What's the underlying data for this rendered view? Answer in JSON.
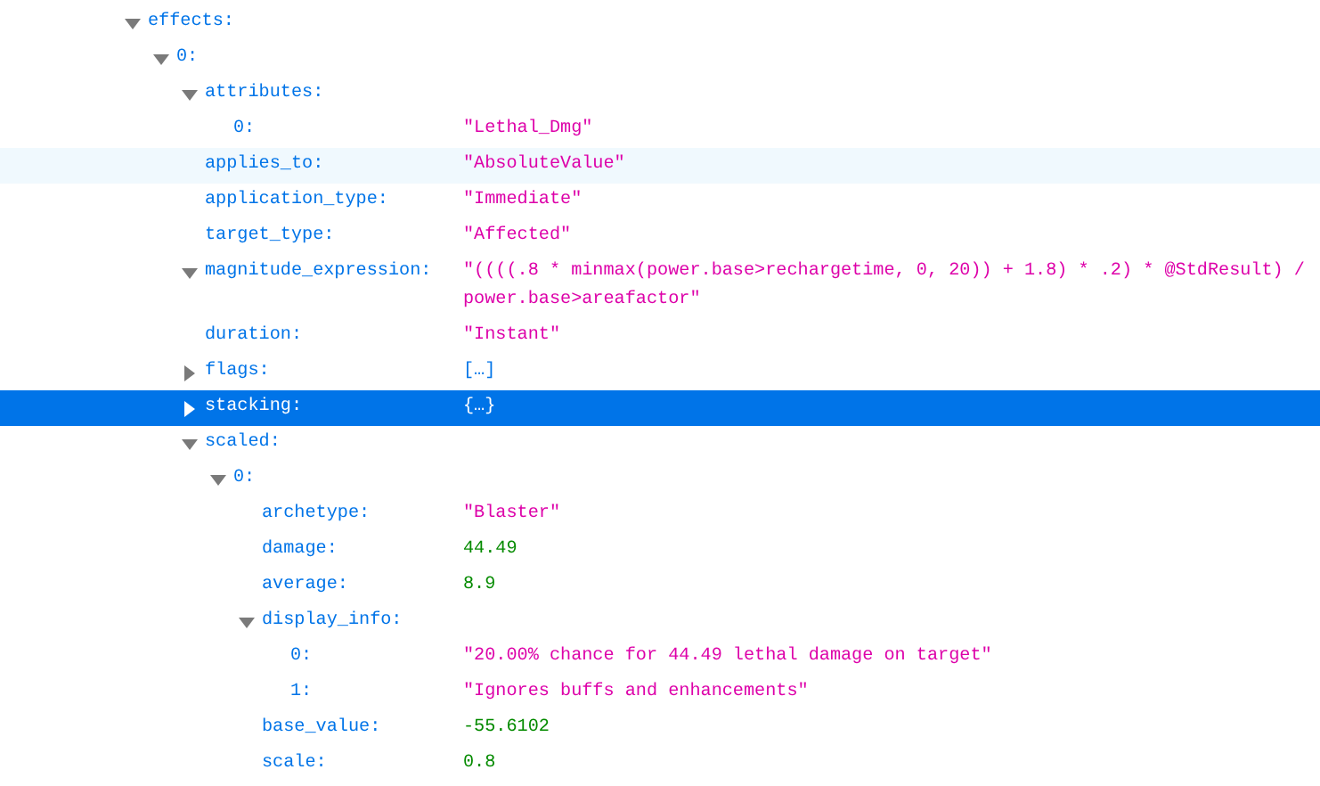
{
  "tree": [
    {
      "key": "effects:",
      "expanded": true,
      "selected": false,
      "hovered": false,
      "children": [
        {
          "key": "0:",
          "expanded": true,
          "selected": false,
          "hovered": false,
          "children": [
            {
              "key": "attributes:",
              "expanded": true,
              "selected": false,
              "hovered": false,
              "children": [
                {
                  "key": "0:",
                  "value": "\"Lethal_Dmg\"",
                  "kind": "string",
                  "selected": false,
                  "hovered": false
                }
              ]
            },
            {
              "key": "applies_to:",
              "value": "\"AbsoluteValue\"",
              "kind": "string",
              "selected": false,
              "hovered": true
            },
            {
              "key": "application_type:",
              "value": "\"Immediate\"",
              "kind": "string",
              "selected": false,
              "hovered": false
            },
            {
              "key": "target_type:",
              "value": "\"Affected\"",
              "kind": "string",
              "selected": false,
              "hovered": false
            },
            {
              "key": "magnitude_expression:",
              "value": "\"((((.8 * minmax(power.base>rechargetime, 0, 20)) + 1.8) * .2) * @StdResult) / power.base>areafactor\"",
              "kind": "string",
              "expanded": true,
              "selected": false,
              "hovered": false
            },
            {
              "key": "duration:",
              "value": "\"Instant\"",
              "kind": "string",
              "selected": false,
              "hovered": false
            },
            {
              "key": "flags:",
              "value": "[…]",
              "kind": "collapsed",
              "expanded": false,
              "selected": false,
              "hovered": false
            },
            {
              "key": "stacking:",
              "value": "{…}",
              "kind": "collapsed",
              "expanded": false,
              "selected": true,
              "hovered": false
            },
            {
              "key": "scaled:",
              "expanded": true,
              "selected": false,
              "hovered": false,
              "children": [
                {
                  "key": "0:",
                  "expanded": true,
                  "selected": false,
                  "hovered": false,
                  "children": [
                    {
                      "key": "archetype:",
                      "value": "\"Blaster\"",
                      "kind": "string",
                      "selected": false,
                      "hovered": false
                    },
                    {
                      "key": "damage:",
                      "value": "44.49",
                      "kind": "number",
                      "selected": false,
                      "hovered": false
                    },
                    {
                      "key": "average:",
                      "value": "8.9",
                      "kind": "number",
                      "selected": false,
                      "hovered": false
                    },
                    {
                      "key": "display_info:",
                      "expanded": true,
                      "selected": false,
                      "hovered": false,
                      "children": [
                        {
                          "key": "0:",
                          "value": "\"20.00% chance for 44.49 lethal damage on target\"",
                          "kind": "string",
                          "selected": false,
                          "hovered": false
                        },
                        {
                          "key": "1:",
                          "value": "\"Ignores buffs and enhancements\"",
                          "kind": "string",
                          "selected": false,
                          "hovered": false
                        }
                      ]
                    },
                    {
                      "key": "base_value:",
                      "value": "-55.6102",
                      "kind": "number",
                      "selected": false,
                      "hovered": false
                    },
                    {
                      "key": "scale:",
                      "value": "0.8",
                      "kind": "number",
                      "selected": false,
                      "hovered": false
                    }
                  ]
                }
              ]
            }
          ]
        }
      ]
    }
  ]
}
